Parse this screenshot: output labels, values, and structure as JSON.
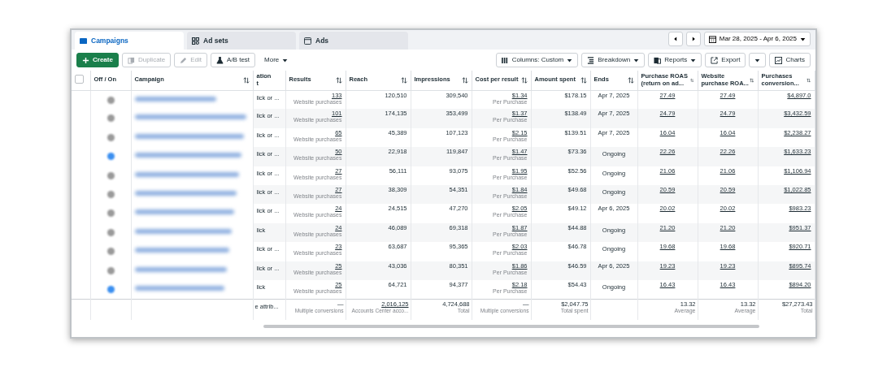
{
  "tabs": [
    {
      "label": "Campaigns",
      "selected": true
    },
    {
      "label": "Ad sets",
      "selected": false
    },
    {
      "label": "Ads",
      "selected": false
    }
  ],
  "date_range": "Mar 28, 2025 - Apr 6, 2025",
  "toolbar_left": [
    {
      "label": "Create",
      "kind": "primary",
      "disabled": false
    },
    {
      "label": "Duplicate",
      "kind": "outline",
      "disabled": true
    },
    {
      "label": "Edit",
      "kind": "outline",
      "disabled": true
    },
    {
      "label": "A/B test",
      "kind": "outline",
      "disabled": false
    },
    {
      "label": "More",
      "kind": "menu",
      "disabled": false
    }
  ],
  "toolbar_right": [
    {
      "label": "Columns: Custom",
      "kind": "menu"
    },
    {
      "label": "Breakdown",
      "kind": "menu"
    },
    {
      "label": "Reports",
      "kind": "menu"
    },
    {
      "label": "Export",
      "kind": "split"
    },
    {
      "label": "Charts",
      "kind": "plain"
    }
  ],
  "select_all_checked": false,
  "columns": [
    "Off / On",
    "Campaign",
    "ation\nt",
    "Results",
    "Reach",
    "Impressions",
    "Cost per result",
    "Amount spent",
    "Ends",
    "Purchase ROAS (return on ad...",
    "Website purchase ROA...",
    "Purchases conversion..."
  ],
  "rows": [
    {
      "on": false,
      "attribution": "lick or ...",
      "results": "133",
      "results_label": "Website purchases",
      "reach": "120,510",
      "impressions": "309,540",
      "cost": "$1.34",
      "cost_label": "Per Purchase",
      "spent": "$178.15",
      "ends": {
        "text": "Apr 7, 2025",
        "kind": "date"
      },
      "roas": "27.49",
      "website_roas": "27.49",
      "purchases_value": "$4,897.0"
    },
    {
      "on": false,
      "attribution": "lick or ...",
      "results": "101",
      "results_label": "Website purchases",
      "reach": "174,135",
      "impressions": "353,499",
      "cost": "$1.37",
      "cost_label": "Per Purchase",
      "spent": "$138.49",
      "ends": {
        "text": "Apr 7, 2025",
        "kind": "date"
      },
      "roas": "24.79",
      "website_roas": "24.79",
      "purchases_value": "$3,432.59"
    },
    {
      "on": false,
      "attribution": "lick or ...",
      "results": "65",
      "results_label": "Website purchases",
      "reach": "45,389",
      "impressions": "107,123",
      "cost": "$2.15",
      "cost_label": "Per Purchase",
      "spent": "$139.51",
      "ends": {
        "text": "Apr 7, 2025",
        "kind": "date"
      },
      "roas": "16.04",
      "website_roas": "16.04",
      "purchases_value": "$2,238.27"
    },
    {
      "on": true,
      "attribution": "lick or ...",
      "results": "50",
      "results_label": "Website purchases",
      "reach": "22,918",
      "impressions": "119,847",
      "cost": "$1.47",
      "cost_label": "Per Purchase",
      "spent": "$73.36",
      "ends": {
        "text": "Ongoing",
        "kind": "status"
      },
      "roas": "22.26",
      "website_roas": "22.26",
      "purchases_value": "$1,633.23"
    },
    {
      "on": false,
      "attribution": "lick or ...",
      "results": "27",
      "results_label": "Website purchases",
      "reach": "56,111",
      "impressions": "93,075",
      "cost": "$1.95",
      "cost_label": "Per Purchase",
      "spent": "$52.56",
      "ends": {
        "text": "Ongoing",
        "kind": "status"
      },
      "roas": "21.06",
      "website_roas": "21.06",
      "purchases_value": "$1,106.94"
    },
    {
      "on": false,
      "attribution": "lick or ...",
      "results": "27",
      "results_label": "Website purchases",
      "reach": "38,309",
      "impressions": "54,351",
      "cost": "$1.84",
      "cost_label": "Per Purchase",
      "spent": "$49.68",
      "ends": {
        "text": "Ongoing",
        "kind": "status"
      },
      "roas": "20.59",
      "website_roas": "20.59",
      "purchases_value": "$1,022.85"
    },
    {
      "on": false,
      "attribution": "lick or ...",
      "results": "24",
      "results_label": "Website purchases",
      "reach": "24,515",
      "impressions": "47,270",
      "cost": "$2.05",
      "cost_label": "Per Purchase",
      "spent": "$49.12",
      "ends": {
        "text": "Apr 6, 2025",
        "kind": "date"
      },
      "roas": "20.02",
      "website_roas": "20.02",
      "purchases_value": "$983.23"
    },
    {
      "on": false,
      "attribution": "lick",
      "results": "24",
      "results_label": "Website purchases",
      "reach": "46,089",
      "impressions": "69,318",
      "cost": "$1.87",
      "cost_label": "Per Purchase",
      "spent": "$44.88",
      "ends": {
        "text": "Ongoing",
        "kind": "status"
      },
      "roas": "21.20",
      "website_roas": "21.20",
      "purchases_value": "$951.37"
    },
    {
      "on": false,
      "attribution": "lick or ...",
      "results": "23",
      "results_label": "Website purchases",
      "reach": "63,687",
      "impressions": "95,365",
      "cost": "$2.03",
      "cost_label": "Per Purchase",
      "spent": "$46.78",
      "ends": {
        "text": "Ongoing",
        "kind": "status"
      },
      "roas": "19.68",
      "website_roas": "19.68",
      "purchases_value": "$920.71"
    },
    {
      "on": false,
      "attribution": "lick or ...",
      "results": "25",
      "results_label": "Website purchases",
      "reach": "43,036",
      "impressions": "80,351",
      "cost": "$1.86",
      "cost_label": "Per Purchase",
      "spent": "$46.59",
      "ends": {
        "text": "Apr 6, 2025",
        "kind": "date"
      },
      "roas": "19.23",
      "website_roas": "19.23",
      "purchases_value": "$895.74"
    },
    {
      "on": true,
      "attribution": "lick",
      "results": "25",
      "results_label": "Website purchases",
      "reach": "64,721",
      "impressions": "94,377",
      "cost": "$2.18",
      "cost_label": "Per Purchase",
      "spent": "$54.43",
      "ends": {
        "text": "Ongoing",
        "kind": "status"
      },
      "roas": "16.43",
      "website_roas": "16.43",
      "purchases_value": "$894.20"
    }
  ],
  "totals": {
    "attribution": "e attrib...",
    "results": "—",
    "results_label": "Multiple conversions",
    "reach": "2,016,125",
    "reach_label": "Accounts Center acco...",
    "impressions": "4,724,688",
    "impressions_label": "Total",
    "cost": "—",
    "cost_label": "Multiple conversions",
    "spent": "$2,047.75",
    "spent_label": "Total spent",
    "roas": "13.32",
    "roas_label": "Average",
    "website_roas": "13.32",
    "website_roas_label": "Average",
    "purchases_value": "$27,273.43",
    "purchases_value_label": "Total"
  }
}
